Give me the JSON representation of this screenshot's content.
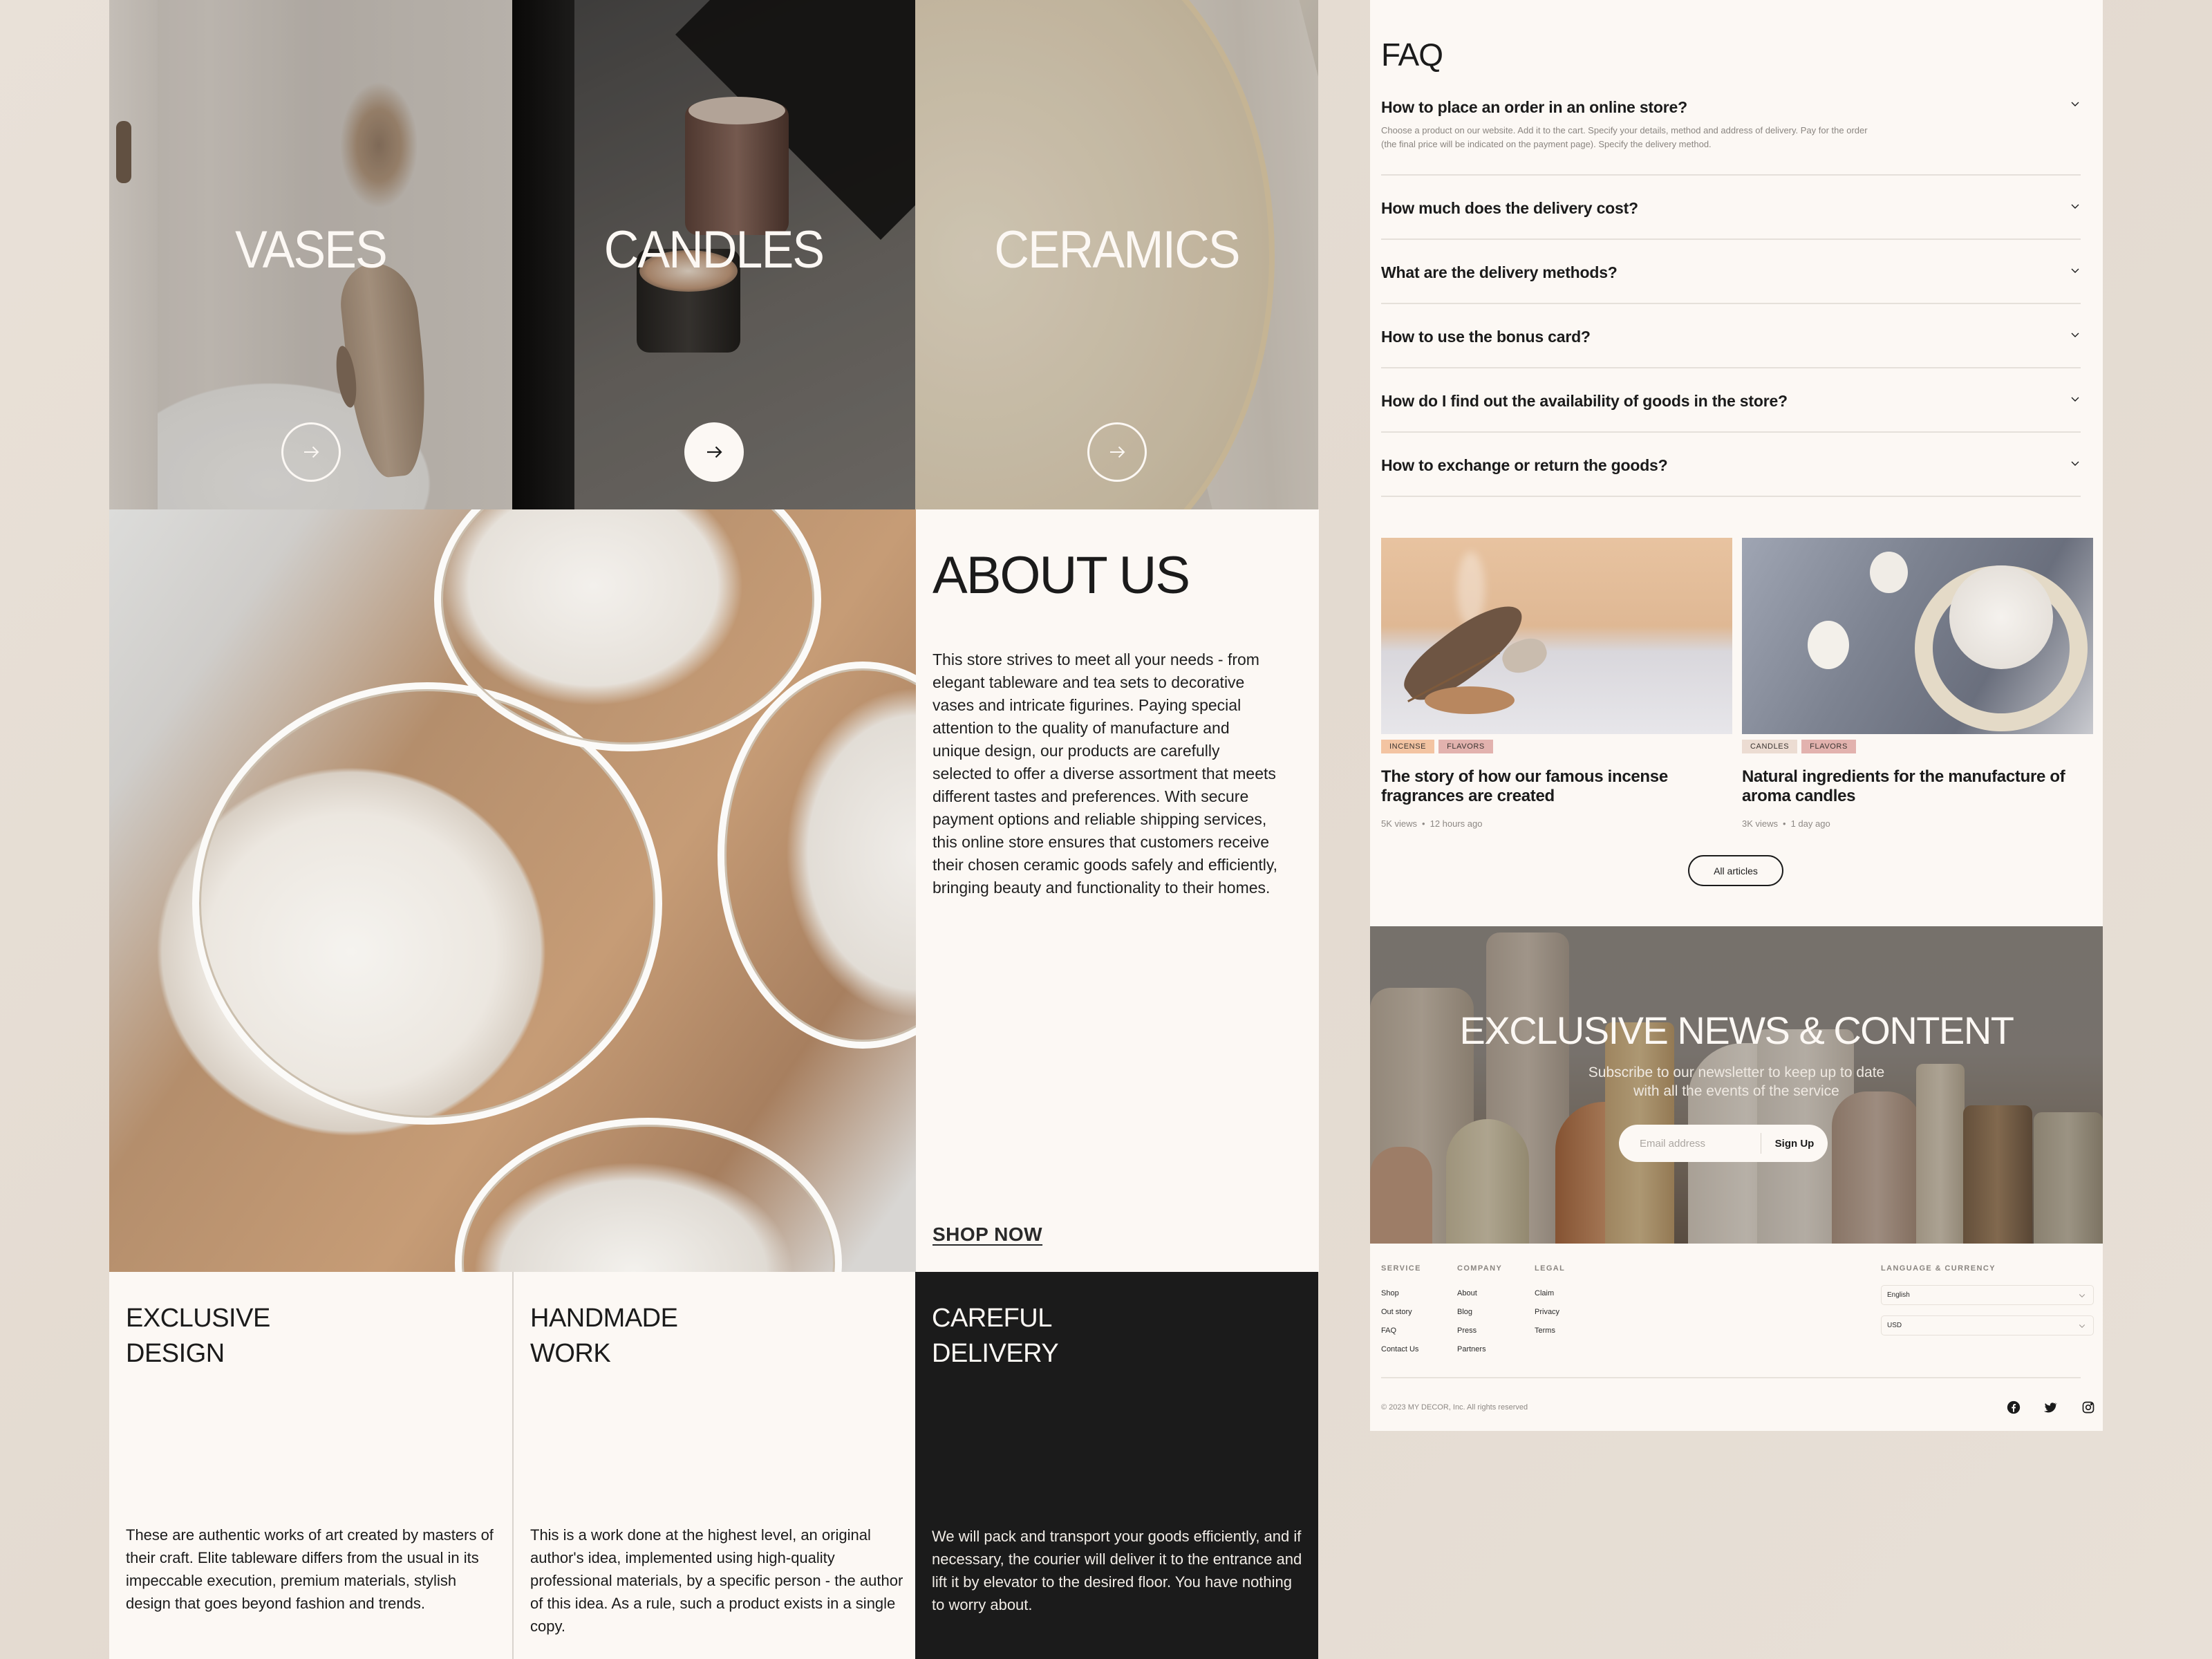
{
  "categories": [
    {
      "title": "VASES",
      "button_icon": "arrow-right-icon",
      "button_style": "outline"
    },
    {
      "title": "CANDLES",
      "button_icon": "arrow-right-icon",
      "button_style": "filled"
    },
    {
      "title": "CERAMICS",
      "button_icon": "arrow-right-icon",
      "button_style": "outline"
    }
  ],
  "about": {
    "title": "ABOUT US",
    "body": "This store strives to meet all your needs - from elegant tableware and tea sets to decorative vases and intricate figurines. Paying special attention to the quality of manufacture and unique design, our products are carefully selected to offer a diverse assortment that meets different tastes and preferences. With secure payment options and reliable shipping services, this online store ensures that customers receive their chosen ceramic goods safely and efficiently, bringing beauty and functionality to their homes.",
    "cta": "SHOP NOW"
  },
  "features": [
    {
      "title": "EXCLUSIVE\nDESIGN",
      "body": "These are authentic works of art created by masters of their craft. Elite tableware differs from the usual in its impeccable execution, premium materials, stylish design that goes beyond fashion and trends."
    },
    {
      "title": "HANDMADE\nWORK",
      "body": "This is a work done at the highest level, an original author's idea, implemented using high-quality professional materials, by a specific person - the author of this idea. As a rule, such a product exists in a single copy."
    },
    {
      "title": "CAREFUL\nDELIVERY",
      "body": "We will pack and transport your goods efficiently, and if necessary, the courier will deliver it to the entrance and lift it by elevator to the desired floor. You have nothing to worry about."
    }
  ],
  "faq": {
    "title": "FAQ",
    "items": [
      {
        "question": "How to place an order in an online store?",
        "answer": "Choose a product on our website. Add it to the cart. Specify your details, method and address of delivery. Pay for the order (the final price will be indicated on the payment page). Specify the delivery method.",
        "expanded": true
      },
      {
        "question": "How much does the delivery cost?",
        "expanded": false
      },
      {
        "question": "What are the delivery methods?",
        "expanded": false
      },
      {
        "question": "How to use the bonus card?",
        "expanded": false
      },
      {
        "question": "How do I find out the availability of goods in the store?",
        "expanded": false
      },
      {
        "question": "How to exchange or return the goods?",
        "expanded": false
      }
    ]
  },
  "articles": {
    "items": [
      {
        "tags": [
          {
            "label": "INCENSE",
            "color": "#f3c4a2"
          },
          {
            "label": "FLAVORS",
            "color": "#e2b2ae"
          }
        ],
        "title": "The story of how our famous incense fragrances are created",
        "views": "5K views",
        "time": "12 hours ago"
      },
      {
        "tags": [
          {
            "label": "CANDLES",
            "color": "#ecdcd2"
          },
          {
            "label": "FLAVORS",
            "color": "#e2b2ae"
          }
        ],
        "title": "Natural ingredients for the manufacture of aroma candles",
        "views": "3K views",
        "time": "1 day ago"
      }
    ],
    "all_label": "All articles"
  },
  "newsletter": {
    "title": "EXCLUSIVE NEWS & CONTENT",
    "subtitle": "Subscribe to our newsletter to keep up to date\nwith all the events of the service",
    "email_placeholder": "Email address",
    "email_value": "",
    "button": "Sign Up"
  },
  "footer": {
    "columns": [
      {
        "heading": "SERVICE",
        "links": [
          "Shop",
          "Out story",
          "FAQ",
          "Contact Us"
        ]
      },
      {
        "heading": "COMPANY",
        "links": [
          "About",
          "Blog",
          "Press",
          "Partners"
        ]
      },
      {
        "heading": "LEGAL",
        "links": [
          "Claim",
          "Privacy",
          "Terms"
        ]
      }
    ],
    "lang_heading": "LANGUAGE & CURRENCY",
    "language": "English",
    "currency": "USD",
    "copyright": "© 2023 MY DECOR, Inc. All rights reserved",
    "social": [
      "facebook-icon",
      "twitter-icon",
      "instagram-icon"
    ]
  },
  "colors": {
    "background": "#e6ddd3",
    "cream": "#fcf8f4",
    "dark": "#1b1b1b",
    "muted_text": "#8a8580"
  }
}
